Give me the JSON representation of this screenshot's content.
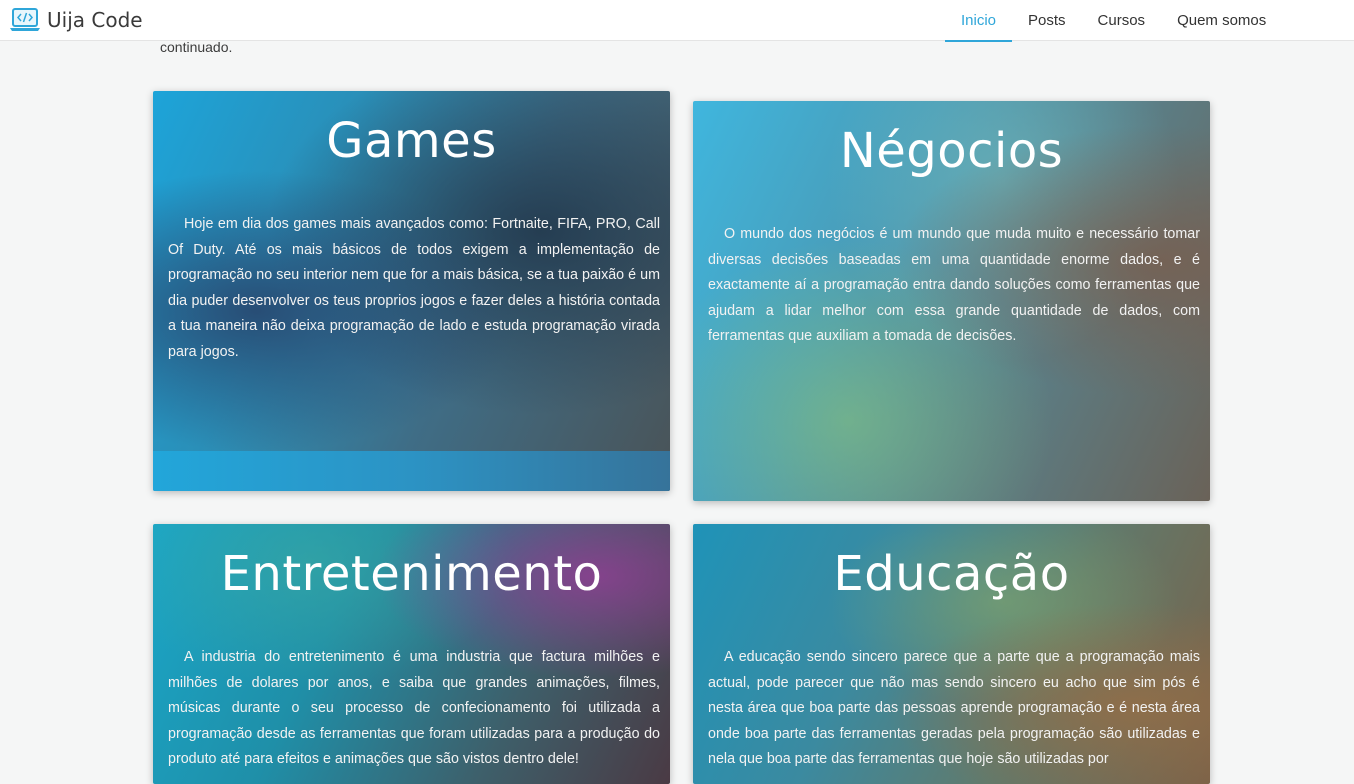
{
  "header": {
    "brand": {
      "name": "Uija Code",
      "icon": "laptop-code-icon"
    },
    "nav": [
      {
        "label": "Inicio",
        "active": true
      },
      {
        "label": "Posts",
        "active": false
      },
      {
        "label": "Cursos",
        "active": false
      },
      {
        "label": "Quem somos",
        "active": false
      }
    ],
    "accent_color": "#2fa6d9"
  },
  "intro": {
    "text": "continuado."
  },
  "cards": {
    "games": {
      "title": "Games",
      "text": "Hoje em dia dos games mais avançados como: Fortnaite, FIFA, PRO, Call Of Duty. Até os mais básicos de todos exigem a implementação de programação no seu interior nem que for a mais básica, se a tua paixão é um dia puder desenvolver os teus proprios jogos e fazer deles a história contada a tua maneira não deixa programação de lado e estuda programação virada para jogos."
    },
    "negocios": {
      "title": "Négocios",
      "text": "O mundo dos negócios é um mundo que muda muito e necessário tomar diversas decisões baseadas em uma quantidade enorme dados, e é exactamente aí a programação entra dando soluções como ferramentas que ajudam a lidar melhor com essa grande quantidade de dados, com ferramentas que auxiliam a tomada de decisões."
    },
    "entretenimento": {
      "title": "Entretenimento",
      "text": "A industria do entretenimento é uma industria que factura milhões e milhões de dolares por anos, e saiba que grandes animações, filmes, músicas durante o seu processo de confecionamento foi utilizada a programação desde as ferramentas que foram utilizadas para a produção do produto até para efeitos e animações que são vistos dentro dele!"
    },
    "educacao": {
      "title": "Educação",
      "text": "A educação sendo sincero parece que a parte que a programação mais actual, pode parecer que não mas sendo sincero eu acho que sim pós é nesta área que boa parte das pessoas aprende programação e é nesta área onde boa parte das ferramentas geradas pela programação são utilizadas e nela que boa parte das ferramentas que hoje são utilizadas por"
    }
  }
}
